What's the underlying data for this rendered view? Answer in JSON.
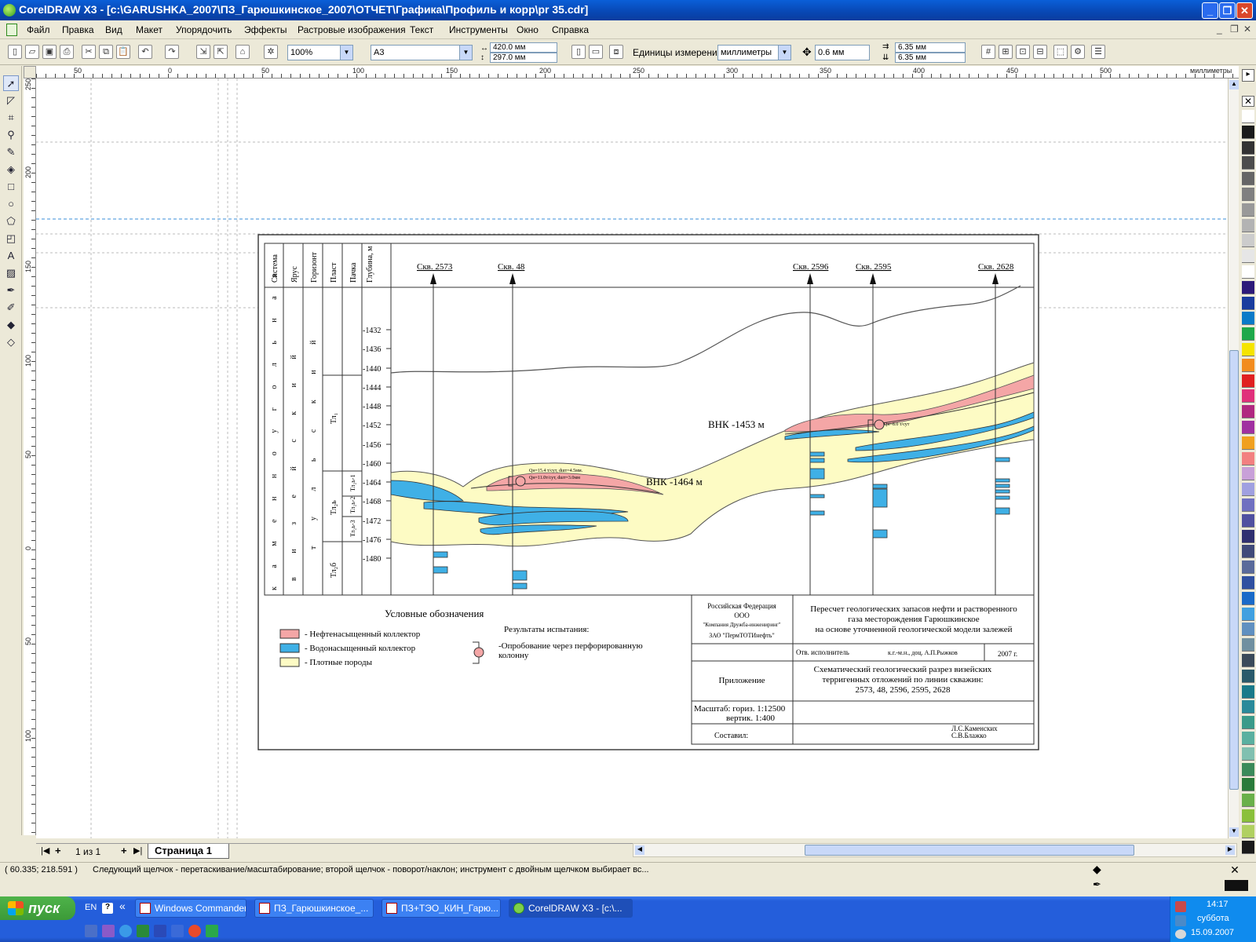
{
  "window": {
    "title": "CorelDRAW X3 - [c:\\GARUSHKA_2007\\ПЗ_Гарюшкинское_2007\\ОТЧЕТ\\Графика\\Профиль и корр\\pr 35.cdr]",
    "minimize": "_",
    "restore": "❐",
    "close": "✕"
  },
  "menu": {
    "items": [
      "Файл",
      "Правка",
      "Вид",
      "Макет",
      "Упорядочить",
      "Эффекты",
      "Растровые изображения",
      "Текст",
      "Инструменты",
      "Окно",
      "Справка"
    ]
  },
  "propbar": {
    "zoom": "100%",
    "page_size": "A3",
    "width": "420.0 мм",
    "height": "297.0 мм",
    "units_label": "Единицы измерения:",
    "units": "миллиметры",
    "nudge": "0.6 мм",
    "dup_x": "6.35 мм",
    "dup_y": "6.35 мм"
  },
  "ruler": {
    "units": "миллиметры",
    "h_ticks": [
      "50",
      "0",
      "50",
      "100",
      "150",
      "200",
      "250",
      "300",
      "350",
      "400",
      "450",
      "500"
    ],
    "v_ticks": [
      "250",
      "200",
      "150",
      "100",
      "50",
      "0",
      "50",
      "100"
    ]
  },
  "pagenav": {
    "counter": "1 из 1",
    "page_tab": "Страница 1"
  },
  "status": {
    "coords": "( 60.335; 218.591 )",
    "hint": "Следующий щелчок - перетаскивание/масштабирование; второй щелчок - поворот/наклон; инструмент с двойным щелчком выбирает вс..."
  },
  "taskbar": {
    "start": "пуск",
    "lang": "EN",
    "tasks": [
      "Windows Commander...",
      "ПЗ_Гарюшкинское_...",
      "ПЗ+ТЭО_КИН_Гарю...",
      "CorelDRAW X3 - [c:\\..."
    ],
    "time": "14:17",
    "day": "суббота",
    "date": "15.09.2007"
  },
  "palette": [
    "#ffffff",
    "#1a1a1a",
    "#333333",
    "#4d4d4d",
    "#666666",
    "#808080",
    "#999999",
    "#b3b3b3",
    "#cccccc",
    "#e6e6e6",
    "#ffffff",
    "#2d1a7a",
    "#1a3d9e",
    "#0a7ac8",
    "#1fa84a",
    "#f5e400",
    "#f28c1f",
    "#e02020",
    "#e0307a",
    "#b02880",
    "#a030a0",
    "#f0a020",
    "#f28080",
    "#c8a0d8",
    "#a0a0e0",
    "#7070c0",
    "#5050a0",
    "#303070",
    "#404a7a",
    "#5a6a9a",
    "#3050a0",
    "#1a6ac8",
    "#40a0e0",
    "#6090c0",
    "#7090a0",
    "#3a4a5a",
    "#2a5a6a",
    "#1a7a8a",
    "#2a8a9a",
    "#3a9a8a",
    "#5ab0a0",
    "#80c0b0",
    "#3a8a5a",
    "#2a7a3a",
    "#6ab04a",
    "#8ac03a",
    "#b0d060",
    "#1a1a1a"
  ],
  "section": {
    "header_cols": [
      "Система",
      "Ярус",
      "Горизонт",
      "Пласт",
      "Пачка",
      "Глубина, м"
    ],
    "system_text": "к а м е н н о у г о л ь н а я",
    "stage_text": "в и з е й с к и й",
    "horizon_text": "т у л ь с к и й",
    "plast_labels": [
      "Тл₁",
      "Тл₂ь",
      "Тл₂б"
    ],
    "pack_labels": [
      "Тл₂ь-1",
      "Тл₂ь-2",
      "Тл₂ь-3"
    ],
    "depths": [
      "-1432",
      "-1436",
      "-1440",
      "-1444",
      "-1448",
      "-1452",
      "-1456",
      "-1460",
      "-1464",
      "-1468",
      "-1472",
      "-1476",
      "-1480"
    ],
    "wells": [
      "Скв. 2573",
      "Скв. 48",
      "Скв. 2596",
      "Скв. 2595",
      "Скв. 2628"
    ],
    "vnk_east": "ВНК -1453 м",
    "vnk_west": "ВНК -1464 м",
    "test_48_a": "Qн=15.4 т/сут, dшт=4.5мм.",
    "test_48_b": "Qн=11.0т/сут, dшт=3.0мм",
    "test_2595": "Qн=8.0 т/сут"
  },
  "legend": {
    "title": "Условные обозначения",
    "items": [
      "- Нефтенасыщенный коллектор",
      "- Водонасыщенный коллектор",
      "- Плотные породы"
    ],
    "colors": [
      "#f4a6a6",
      "#3fb0e6",
      "#fdfbc4"
    ],
    "tests_title": "Результаты испытания:",
    "tests_item_1": "-Опробование через перфорированную",
    "tests_item_2": "колонну"
  },
  "stamp": {
    "org_1": "Российская Федерация",
    "org_2": "ООО",
    "org_3": "\"Компания Дружба-инжениринг\"",
    "org_4": "ЗАО \"ПермТОТИнефть\"",
    "project_1": "Пересчет геологических запасов нефти и растворенного",
    "project_2": "газа  месторождения Гарюшкинское",
    "project_3": "на основе уточненной геологической модели залежей",
    "exec_label": "Отв. исполнитель",
    "exec_name": "к.г.-м.н., доц. А.П.Рыжков",
    "year": "2007 г.",
    "appendix": "Приложение",
    "drawing_1": "Схематический геологический разрез визейских",
    "drawing_2": "терригенных отложений по линии скважин:",
    "drawing_3": "2573, 48, 2596, 2595, 2628",
    "scale_1": "Масштаб: гориз. 1:12500",
    "scale_2": "вертик. 1:400",
    "composed": "Составил:",
    "author_1": "Л.С.Каменских",
    "author_2": "С.В.Блажко"
  }
}
